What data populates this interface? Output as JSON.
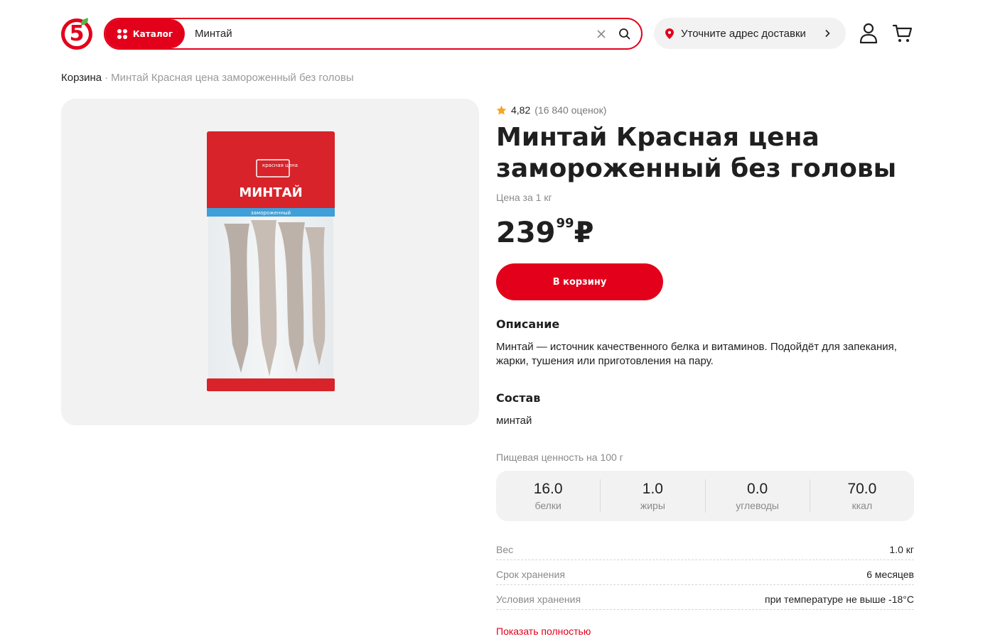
{
  "header": {
    "logo_text": "5",
    "catalog_label": "Каталог",
    "search_value": "Минтай",
    "address_label": "Уточните адрес доставки"
  },
  "breadcrumb": {
    "items": [
      "Корзина",
      "Минтай Красная цена замороженный без головы"
    ],
    "separator": "·"
  },
  "product": {
    "pack_brand": "красная цена",
    "pack_name": "МИНТАЙ",
    "pack_band": "замороженный",
    "rating_value": "4,82",
    "rating_count": "(16 840 оценок)",
    "title": "Минтай Красная цена замороженный без головы",
    "unit_label": "Цена за 1 кг",
    "price_rub": "239",
    "price_kop": "99",
    "currency": "₽",
    "add_to_cart_label": "В корзину",
    "description_title": "Описание",
    "description": "Минтай — источник качественного белка и витаминов. Подойдёт для запекания, жарки, тушения или приготовления на пару.",
    "composition_title": "Состав",
    "composition": "минтай",
    "nutrition_title": "Пищевая ценность на 100 г",
    "nutrition": [
      {
        "value": "16.0",
        "name": "белки"
      },
      {
        "value": "1.0",
        "name": "жиры"
      },
      {
        "value": "0.0",
        "name": "углеводы"
      },
      {
        "value": "70.0",
        "name": "ккал"
      }
    ],
    "specs": [
      {
        "name": "Вес",
        "value": "1.0 кг"
      },
      {
        "name": "Срок хранения",
        "value": "6 месяцев"
      },
      {
        "name": "Условия хранения",
        "value": "при температуре не выше -18°C"
      }
    ],
    "show_more_label": "Показать полностью"
  },
  "colors": {
    "brand_red": "#e3001b",
    "brand_green": "#4fb848",
    "star": "#f5a623"
  }
}
